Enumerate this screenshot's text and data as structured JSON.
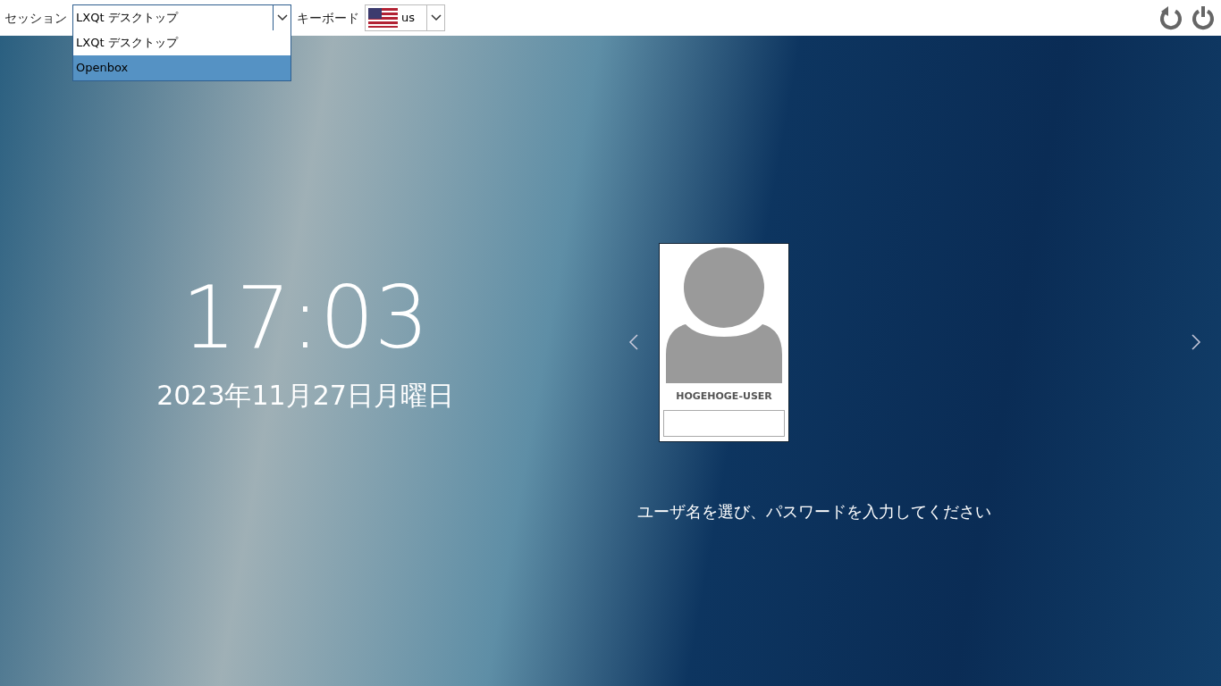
{
  "top_bar": {
    "session_label": "セッション",
    "session_select": {
      "value": "LXQt デスクトップ",
      "expanded": true,
      "options": [
        {
          "label": "LXQt デスクトップ",
          "highlighted": false
        },
        {
          "label": "Openbox",
          "highlighted": true
        }
      ]
    },
    "keyboard_label": "キーボード",
    "keyboard_select": {
      "value": "us"
    }
  },
  "clock": {
    "time": "17:03",
    "date": "2023年11月27日月曜日"
  },
  "user": {
    "name": "HOGEHOGE-USER"
  },
  "prompt": "ユーザ名を選び、パスワードを入力してください"
}
